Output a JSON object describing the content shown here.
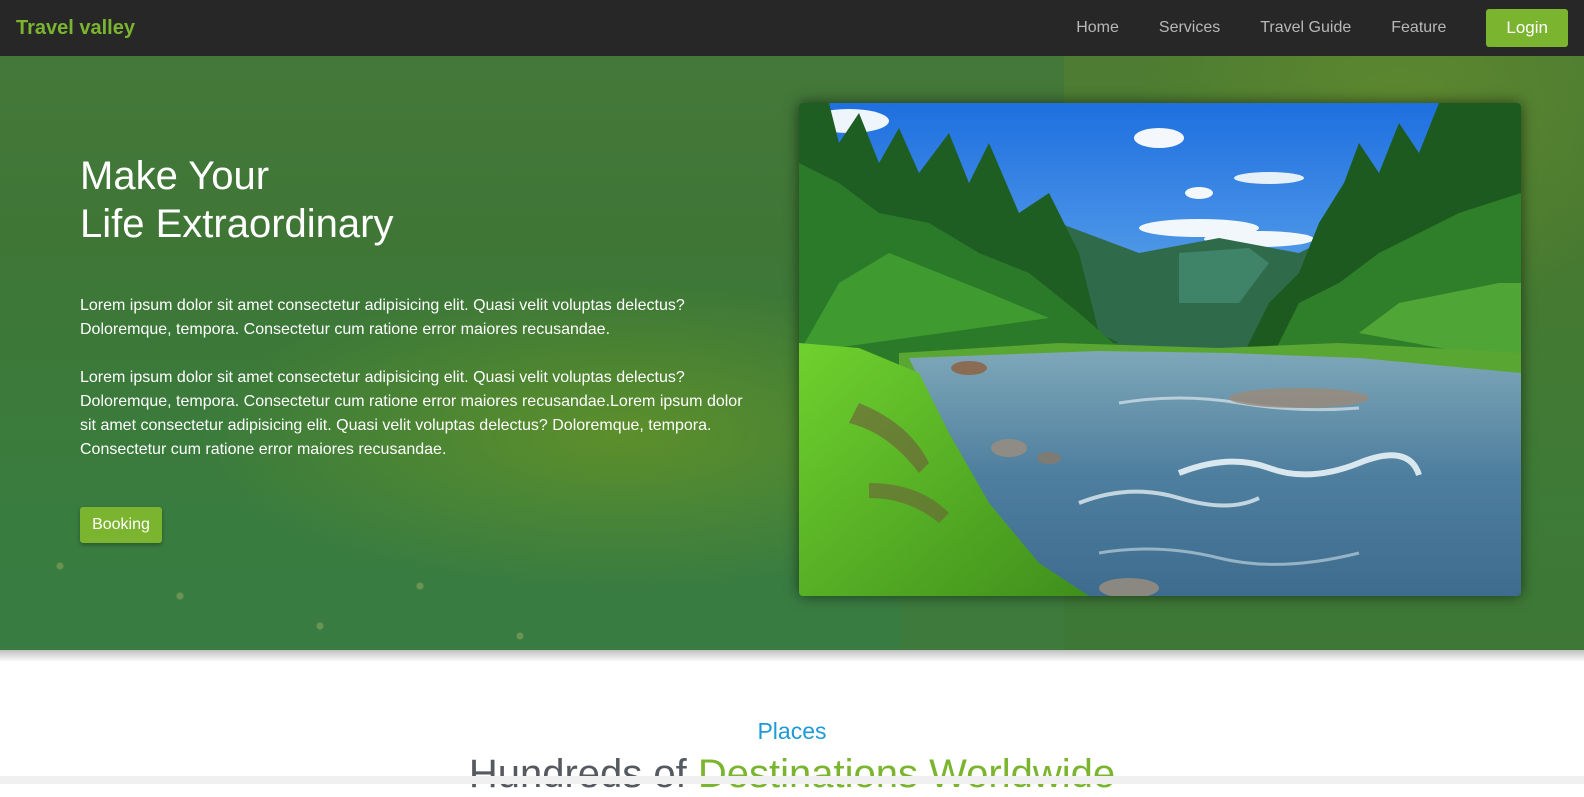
{
  "navbar": {
    "brand": "Travel valley",
    "links": [
      "Home",
      "Services",
      "Travel Guide",
      "Feature"
    ],
    "login_label": "Login"
  },
  "hero": {
    "title_line1": "Make Your",
    "title_line2": "Life Extraordinary",
    "paragraph1": "Lorem ipsum dolor sit amet consectetur adipisicing elit. Quasi velit voluptas delectus? Doloremque, tempora. Consectetur cum ratione error maiores recusandae.",
    "paragraph2": "Lorem ipsum dolor sit amet consectetur adipisicing elit. Quasi velit voluptas delectus? Doloremque, tempora. Consectetur cum ratione error maiores recusandae.Lorem ipsum dolor sit amet consectetur adipisicing elit. Quasi velit voluptas delectus? Doloremque, tempora. Consectetur cum ratione error maiores recusandae.",
    "booking_label": "Booking",
    "image_icon": "landscape-river-forest"
  },
  "places": {
    "label": "Places",
    "heading_part1": "Hundreds of",
    "heading_part2": "Destinations Worldwide"
  },
  "colors": {
    "accent_green": "#7bb52f",
    "nav_bg": "#272727",
    "places_blue": "#1e9ad6"
  }
}
